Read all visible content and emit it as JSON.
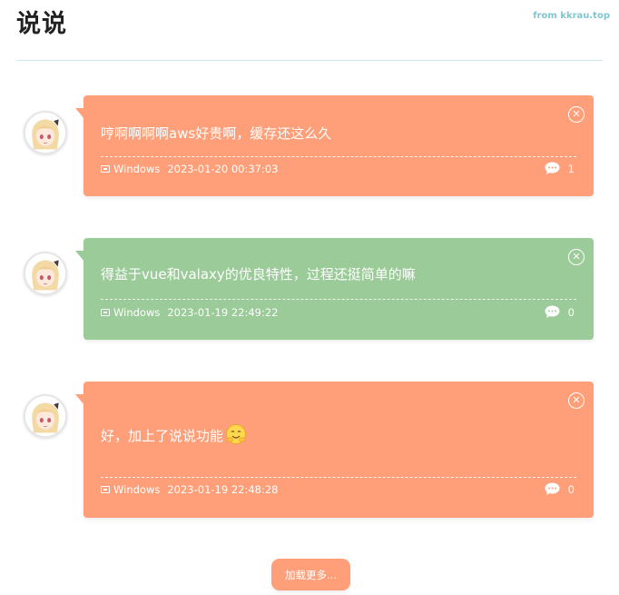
{
  "header": {
    "title": "说说",
    "source": "from kkrau.top"
  },
  "colors": {
    "orange": "#ff9f79",
    "green": "#9bcb98",
    "divider": "#cfe8ec",
    "source_link": "#7fc6cf"
  },
  "posts": [
    {
      "content": "哼啊啊啊啊aws好贵啊，缓存还这么久",
      "device": "Windows",
      "timestamp": "2023-01-20 00:37:03",
      "comments": "1",
      "color": "orange"
    },
    {
      "content": "得益于vue和valaxy的优良特性，过程还挺简单的嘛",
      "device": "Windows",
      "timestamp": "2023-01-19 22:49:22",
      "comments": "0",
      "color": "green"
    },
    {
      "content": "好，加上了说说功能",
      "emoji": "smiling-face-emoji",
      "device": "Windows",
      "timestamp": "2023-01-19 22:48:28",
      "comments": "0",
      "color": "orange"
    }
  ],
  "load_more_label": "加载更多..."
}
